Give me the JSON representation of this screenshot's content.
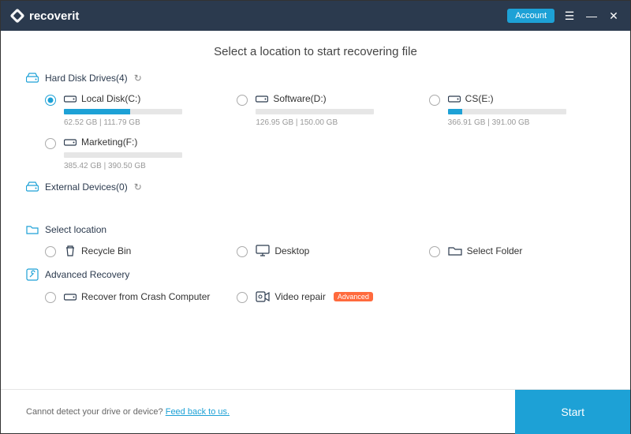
{
  "app": {
    "name": "recoverit"
  },
  "titlebar": {
    "account_label": "Account"
  },
  "page_title": "Select a location to start recovering file",
  "sections": {
    "hard_disk": {
      "label": "Hard Disk Drives(4)"
    },
    "external": {
      "label": "External Devices(0)"
    },
    "select_location": {
      "label": "Select location"
    },
    "advanced": {
      "label": "Advanced Recovery"
    }
  },
  "drives": [
    {
      "name": "Local Disk(C:)",
      "used_gb": 62.52,
      "total_gb": 111.79,
      "size_text": "62.52  GB | 111.79  GB",
      "fill_pct": 56,
      "selected": true
    },
    {
      "name": "Software(D:)",
      "used_gb": 126.95,
      "total_gb": 150.0,
      "size_text": "126.95  GB | 150.00  GB",
      "fill_pct": 0,
      "selected": false
    },
    {
      "name": "CS(E:)",
      "used_gb": 366.91,
      "total_gb": 391.0,
      "size_text": "366.91  GB | 391.00  GB",
      "fill_pct": 12,
      "selected": false
    },
    {
      "name": "Marketing(F:)",
      "used_gb": 385.42,
      "total_gb": 390.5,
      "size_text": "385.42  GB | 390.50  GB",
      "fill_pct": 0,
      "selected": false
    }
  ],
  "locations": [
    {
      "name": "Recycle Bin",
      "icon": "trash"
    },
    {
      "name": "Desktop",
      "icon": "desktop"
    },
    {
      "name": "Select Folder",
      "icon": "folder"
    }
  ],
  "advanced_items": [
    {
      "name": "Recover from Crash Computer",
      "icon": "disk",
      "badge": null
    },
    {
      "name": "Video repair",
      "icon": "video-gear",
      "badge": "Advanced"
    }
  ],
  "footer": {
    "text": "Cannot detect your drive or device? ",
    "link": "Feed back to us.",
    "start_label": "Start"
  },
  "colors": {
    "accent": "#1da1d6",
    "header": "#2b3a4e",
    "badge": "#ff6a3d"
  }
}
